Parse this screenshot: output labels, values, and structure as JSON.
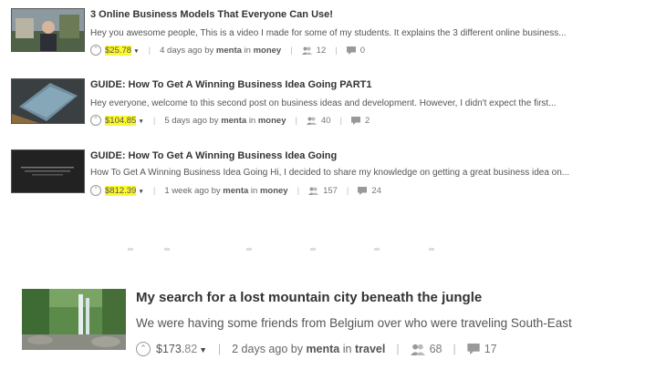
{
  "posts": [
    {
      "title": "3 Online Business Models That Everyone Can Use!",
      "excerpt": "Hey you awesome people, This is a video I made for some of my students. It explains the 3 different online business...",
      "payout": "$25.78",
      "age": "4 days ago by",
      "author": "menta",
      "in_word": "in",
      "category": "money",
      "votes": "12",
      "comments": "0"
    },
    {
      "title": "GUIDE: How To Get A Winning Business Idea Going PART1",
      "excerpt": "Hey everyone, welcome to this second post on business ideas and development. However, I didn't expect the first...",
      "payout": "$104.85",
      "age": "5 days ago by",
      "author": "menta",
      "in_word": "in",
      "category": "money",
      "votes": "40",
      "comments": "2"
    },
    {
      "title": "GUIDE: How To Get A Winning Business Idea Going",
      "excerpt": "How To Get A Winning Business Idea Going Hi, I decided to share my knowledge on getting a great business idea on...",
      "payout": "$812.39",
      "age": "1 week ago by",
      "author": "menta",
      "in_word": "in",
      "category": "money",
      "votes": "157",
      "comments": "24"
    },
    {
      "title": "My search for a lost mountain city beneath the jungle",
      "excerpt": "We were having some friends from Belgium over who were traveling South-East",
      "payout_whole": "$173.",
      "payout_cents": "82",
      "age": "2 days ago by",
      "author": "menta",
      "in_word": "in",
      "category": "travel",
      "votes": "68",
      "comments": "17"
    }
  ],
  "icons": {
    "upvote": "chevron-up-circle-icon",
    "dropdown": "caret-down-icon",
    "voters": "people-icon",
    "comments": "comment-icon"
  },
  "colors": {
    "highlight": "#fbf82d",
    "title": "#333333",
    "meta": "#666666"
  }
}
